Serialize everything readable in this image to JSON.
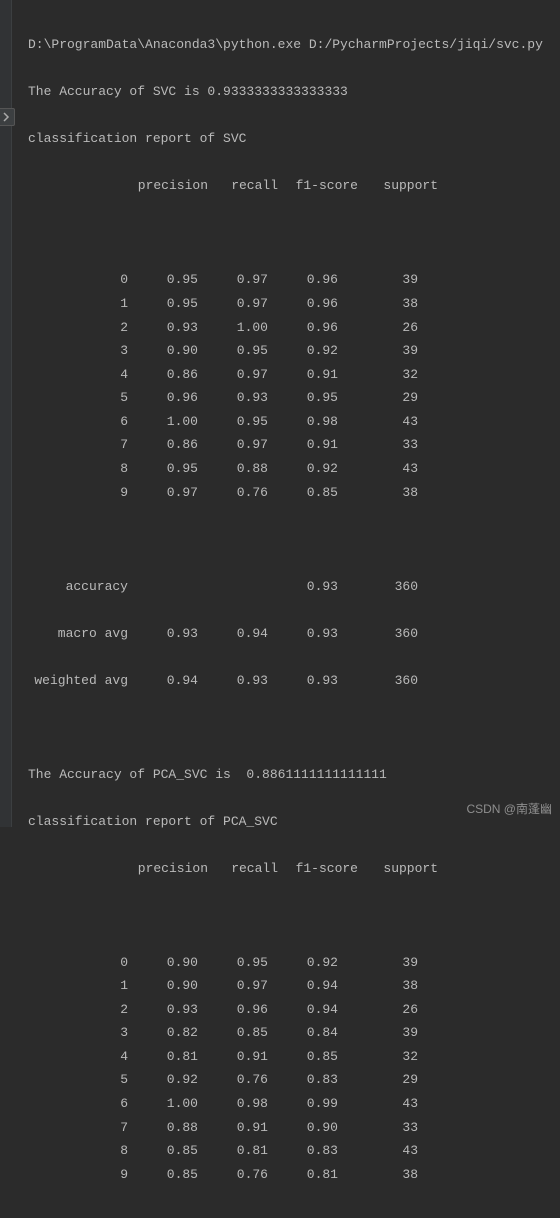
{
  "command_line": "D:\\ProgramData\\Anaconda3\\python.exe D:/PycharmProjects/jiqi/svc.py",
  "svc": {
    "accuracy_line": "The Accuracy of SVC is 0.9333333333333333",
    "report_title": "classification report of SVC",
    "headers": {
      "precision": "precision",
      "recall": "recall",
      "f1": "f1-score",
      "support": "support"
    },
    "rows": [
      {
        "label": "0",
        "precision": "0.95",
        "recall": "0.97",
        "f1": "0.96",
        "support": "39"
      },
      {
        "label": "1",
        "precision": "0.95",
        "recall": "0.97",
        "f1": "0.96",
        "support": "38"
      },
      {
        "label": "2",
        "precision": "0.93",
        "recall": "1.00",
        "f1": "0.96",
        "support": "26"
      },
      {
        "label": "3",
        "precision": "0.90",
        "recall": "0.95",
        "f1": "0.92",
        "support": "39"
      },
      {
        "label": "4",
        "precision": "0.86",
        "recall": "0.97",
        "f1": "0.91",
        "support": "32"
      },
      {
        "label": "5",
        "precision": "0.96",
        "recall": "0.93",
        "f1": "0.95",
        "support": "29"
      },
      {
        "label": "6",
        "precision": "1.00",
        "recall": "0.95",
        "f1": "0.98",
        "support": "43"
      },
      {
        "label": "7",
        "precision": "0.86",
        "recall": "0.97",
        "f1": "0.91",
        "support": "33"
      },
      {
        "label": "8",
        "precision": "0.95",
        "recall": "0.88",
        "f1": "0.92",
        "support": "43"
      },
      {
        "label": "9",
        "precision": "0.97",
        "recall": "0.76",
        "f1": "0.85",
        "support": "38"
      }
    ],
    "summary": {
      "accuracy": {
        "label": "accuracy",
        "f1": "0.93",
        "support": "360"
      },
      "macro": {
        "label": "macro avg",
        "precision": "0.93",
        "recall": "0.94",
        "f1": "0.93",
        "support": "360"
      },
      "weighted": {
        "label": "weighted avg",
        "precision": "0.94",
        "recall": "0.93",
        "f1": "0.93",
        "support": "360"
      }
    }
  },
  "pca_svc": {
    "accuracy_line": "The Accuracy of PCA_SVC is  0.8861111111111111",
    "report_title": "classification report of PCA_SVC",
    "headers": {
      "precision": "precision",
      "recall": "recall",
      "f1": "f1-score",
      "support": "support"
    },
    "rows": [
      {
        "label": "0",
        "precision": "0.90",
        "recall": "0.95",
        "f1": "0.92",
        "support": "39"
      },
      {
        "label": "1",
        "precision": "0.90",
        "recall": "0.97",
        "f1": "0.94",
        "support": "38"
      },
      {
        "label": "2",
        "precision": "0.93",
        "recall": "0.96",
        "f1": "0.94",
        "support": "26"
      },
      {
        "label": "3",
        "precision": "0.82",
        "recall": "0.85",
        "f1": "0.84",
        "support": "39"
      },
      {
        "label": "4",
        "precision": "0.81",
        "recall": "0.91",
        "f1": "0.85",
        "support": "32"
      },
      {
        "label": "5",
        "precision": "0.92",
        "recall": "0.76",
        "f1": "0.83",
        "support": "29"
      },
      {
        "label": "6",
        "precision": "1.00",
        "recall": "0.98",
        "f1": "0.99",
        "support": "43"
      },
      {
        "label": "7",
        "precision": "0.88",
        "recall": "0.91",
        "f1": "0.90",
        "support": "33"
      },
      {
        "label": "8",
        "precision": "0.85",
        "recall": "0.81",
        "f1": "0.83",
        "support": "43"
      },
      {
        "label": "9",
        "precision": "0.85",
        "recall": "0.76",
        "f1": "0.81",
        "support": "38"
      }
    ]
  },
  "watermark": "CSDN @南蓬幽"
}
